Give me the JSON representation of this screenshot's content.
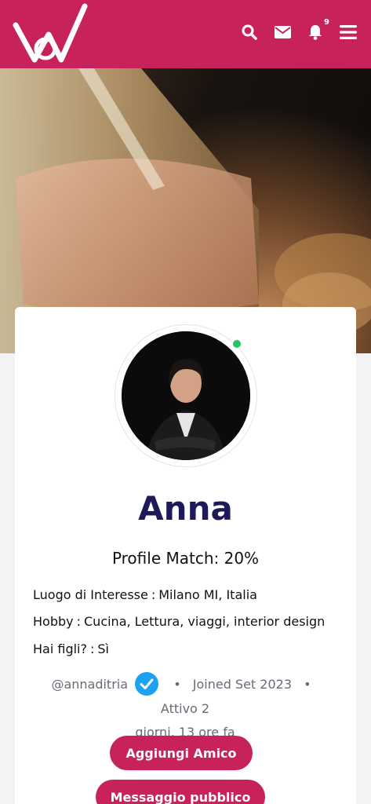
{
  "header": {
    "brand_color": "#c8225c",
    "logo_icon": "w-logo-icon",
    "icons": [
      "search-icon",
      "mail-icon",
      "bell-icon",
      "menu-icon"
    ],
    "notification_count": "9"
  },
  "profile": {
    "name": "Anna",
    "match_label": "Profile Match:",
    "match_value": "20%",
    "online": true,
    "details": [
      {
        "label": "Luogo di Interesse",
        "value": "Milano MI, Italia"
      },
      {
        "label": "Hobby",
        "value": "Cucina, Lettura, viaggi, interior design"
      },
      {
        "label": "Hai figli?",
        "value": "Sì"
      }
    ],
    "username": "@annaditria",
    "joined": "Joined Set 2023",
    "active_line1": "Attivo 2",
    "active_line2": "giorni, 13 ore fa"
  },
  "actions": {
    "add_friend": "Aggiungi Amico",
    "public_message": "Messaggio pubblico"
  }
}
